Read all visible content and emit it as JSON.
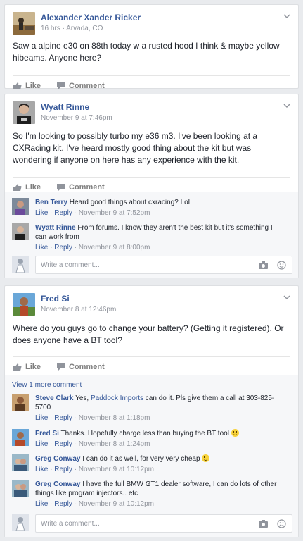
{
  "posts": [
    {
      "author": "Alexander Xander Ricker",
      "meta": "16 hrs · Arvada, CO",
      "text": "Saw a alpine e30 on 88th today w a rusted hood I think & maybe yellow hibeams. Anyone here?",
      "like_label": "Like",
      "comment_label": "Comment"
    },
    {
      "author": "Wyatt Rinne",
      "meta": "November 9 at 7:46pm",
      "text": "So I'm looking to possibly turbo my e36 m3. I've been looking at a CXRacing kit. I've heard mostly good thing about the kit but was wondering if anyone on here has any experience with the kit.",
      "like_label": "Like",
      "comment_label": "Comment",
      "comments": [
        {
          "name": "Ben Terry",
          "text": "Heard good things about cxracing? Lol",
          "like": "Like",
          "reply": "Reply",
          "time": "November 9 at 7:52pm"
        },
        {
          "name": "Wyatt Rinne",
          "text": "From forums. I know they aren't the best kit but it's something I can work from",
          "like": "Like",
          "reply": "Reply",
          "time": "November 9 at 8:00pm"
        }
      ],
      "write_placeholder": "Write a comment..."
    },
    {
      "author": "Fred Si",
      "meta": "November 8 at 12:46pm",
      "text": "Where do you guys go to change your battery? (Getting it registered). Or does anyone have a BT tool?",
      "like_label": "Like",
      "comment_label": "Comment",
      "more_comments": "View 1 more comment",
      "comments": [
        {
          "name": "Steve Clark",
          "text_before": "Yes,",
          "link": "Paddock Imports",
          "text": "can do it. Pls give them a call at 303-825-5700",
          "like": "Like",
          "reply": "Reply",
          "time": "November 8 at 1:18pm"
        },
        {
          "name": "Fred Si",
          "text": "Thanks. Hopefully charge less than buying the BT tool",
          "like": "Like",
          "reply": "Reply",
          "time": "November 8 at 1:24pm"
        },
        {
          "name": "Greg Conway",
          "text": "I can do it as well, for very very cheap",
          "like": "Like",
          "reply": "Reply",
          "time": "November 9 at 10:12pm"
        },
        {
          "name": "Greg Conway",
          "text": "I have the full BMW GT1 dealer software, I can do lots of other things like program injectors.. etc",
          "like": "Like",
          "reply": "Reply",
          "time": "November 9 at 10:12pm"
        }
      ],
      "write_placeholder": "Write a comment..."
    }
  ],
  "colors": {
    "link": "#365899",
    "meta": "#90949c",
    "background": "#e9ebee"
  }
}
